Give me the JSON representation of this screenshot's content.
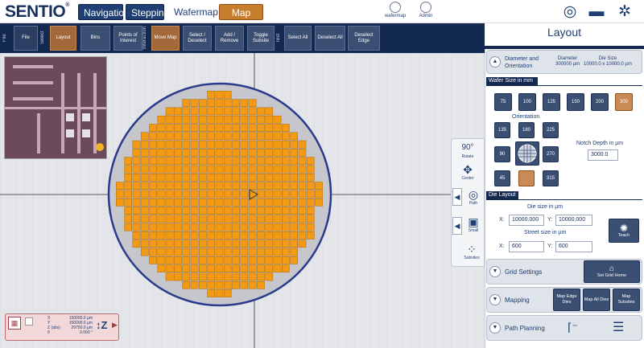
{
  "app": {
    "logo": "SENTIO",
    "reg": "®"
  },
  "topnav": {
    "navigation": "Navigation",
    "stepping": "Stepping",
    "wafermap": "Wafermap",
    "map_setup": "Map Setup"
  },
  "user_icons": {
    "wafermap": "wafermap",
    "admin": "Admin"
  },
  "groups": {
    "file": "File",
    "select": "Select",
    "interaction": "Interaction",
    "test": "Test"
  },
  "toolbar": {
    "file": "File",
    "layout": "Layout",
    "bins": "Bins",
    "poi": "Points of Interest",
    "move_map": "Move Map",
    "select_deselect": "Select / Deselect",
    "add_remove": "Add / Remove",
    "toggle_subsite": "Toggle Subsite",
    "select_all": "Select All",
    "deselect_all": "Deselect All",
    "deselect_edge": "Deselect Edge"
  },
  "coords": {
    "x_label": "X",
    "y_label": "Y",
    "z_label": "Z (abs)",
    "t_label": "θ",
    "x": "150000.0 µm",
    "y": "150000.0 µm",
    "z": "29750.0 µm",
    "theta": "0.000 °"
  },
  "sidebar": {
    "rotate_deg": "90°",
    "rotate": "Rotate",
    "center": "Center",
    "path": "Path",
    "small": "Small",
    "subsites": "Subsites"
  },
  "right": {
    "title": "Layout",
    "diameter_orientation": "Diameter and Orientation",
    "diameter_label": "Diameter",
    "diameter_value": "300000 µm",
    "die_size_label": "Die Size",
    "die_size_value": "10000.0 x 10000.0 µm",
    "wafer_size_title": "Wafer Size in mm",
    "wafer_sizes": [
      "75",
      "100",
      "125",
      "150",
      "200",
      "300"
    ],
    "orientation": "Orientation",
    "orient_values": [
      "135",
      "180",
      "225",
      "90",
      "270",
      "45",
      "0",
      "315"
    ],
    "notch_label": "Notch Depth in µm",
    "notch_value": "3000.0",
    "die_layout": "Die Layout",
    "die_size_title": "Die size in µm",
    "die_x": "10000.000",
    "die_y": "10000.000",
    "street_title": "Street size in µm",
    "street_x": "600",
    "street_y": "600",
    "x": "X:",
    "y": "Y:",
    "teach": "Teach",
    "grid_settings": "Grid Settings",
    "set_grid_home": "Set Grid Home",
    "mapping": "Mapping",
    "map_edge": "Map Edge Dies",
    "map_all": "Map All Dies",
    "map_subsites": "Map Subsites",
    "path_planning": "Path Planning"
  },
  "colors": {
    "navy": "#13294f",
    "die": "#f39a12",
    "die_border": "#b06a06",
    "active": "#c77d2e",
    "wafer_ring": "#2a3a8c"
  }
}
